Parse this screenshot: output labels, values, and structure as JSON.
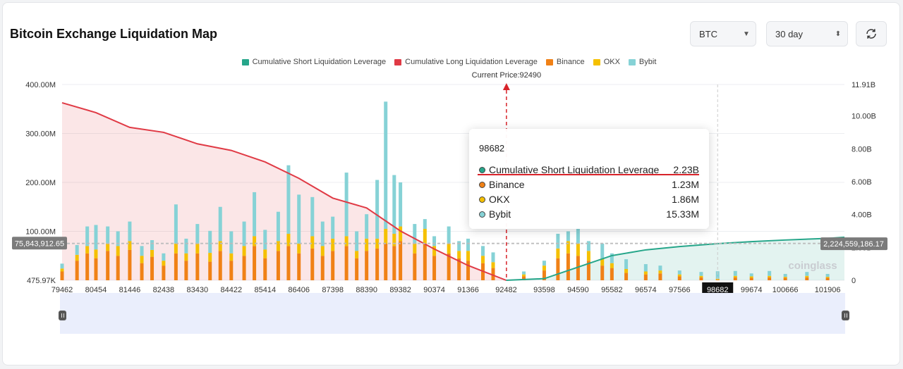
{
  "header": {
    "title": "Bitcoin Exchange Liquidation Map",
    "symbol_select": "BTC",
    "range_select": "30 day",
    "refresh_icon": "refresh-icon"
  },
  "colors": {
    "short": "#26a68a",
    "long": "#e03a45",
    "binance": "#f08116",
    "okx": "#f5c000",
    "bybit": "#86d2d6"
  },
  "current_price_label": "Current Price:92490",
  "left_marker_label": "75,843,912.65",
  "right_marker_label": "2,224,559,186.17",
  "watermark": "coinglass",
  "tooltip": {
    "title": "98682",
    "rows": [
      {
        "label": "Cumulative Short Liquidation Leverage",
        "value": "2.23B"
      },
      {
        "label": "Binance",
        "value": "1.23M"
      },
      {
        "label": "OKX",
        "value": "1.86M"
      },
      {
        "label": "Bybit",
        "value": "15.33M"
      }
    ]
  },
  "chart_data": {
    "type": "bar",
    "title": "Bitcoin Exchange Liquidation Map",
    "legend": [
      "Cumulative Short Liquidation Leverage",
      "Cumulative Long Liquidation Leverage",
      "Binance",
      "OKX",
      "Bybit"
    ],
    "legend_position": "top-center",
    "current_price": 92490,
    "hover_x": "98682",
    "x_ticks": [
      "79462",
      "80454",
      "81446",
      "82438",
      "83430",
      "84422",
      "85414",
      "86406",
      "87398",
      "88390",
      "89382",
      "90374",
      "91366",
      "92482",
      "93598",
      "94590",
      "95582",
      "96574",
      "97566",
      "98682",
      "99674",
      "100666",
      "101906"
    ],
    "x_range": [
      79462,
      102400
    ],
    "y_left_ticks": [
      "475.97K",
      "100.00M",
      "200.00M",
      "300.00M",
      "400.00M"
    ],
    "y_left_range": [
      0,
      400000000
    ],
    "y_right_ticks": [
      "0",
      "2.00B",
      "4.00B",
      "6.00B",
      "8.00B",
      "10.00B",
      "11.91B"
    ],
    "y_right_range": [
      0,
      11910000000
    ],
    "bar_series_note": "stacked per price level (millions)",
    "long_cumulative": {
      "name": "Cumulative Long Liquidation Leverage",
      "x": [
        79462,
        80454,
        81446,
        82438,
        83430,
        84422,
        85414,
        86406,
        87398,
        88390,
        89382,
        90374,
        91366,
        92482
      ],
      "y_b": [
        10.8,
        10.2,
        9.3,
        9.0,
        8.3,
        7.9,
        7.2,
        6.2,
        5.0,
        4.4,
        3.0,
        1.9,
        0.9,
        0.0
      ]
    },
    "short_cumulative": {
      "name": "Cumulative Short Liquidation Leverage",
      "x": [
        92482,
        93598,
        94590,
        95582,
        96574,
        97566,
        98682,
        99674,
        100666,
        101906,
        102400
      ],
      "y_b": [
        0.0,
        0.1,
        0.8,
        1.5,
        1.85,
        2.05,
        2.23,
        2.35,
        2.45,
        2.55,
        2.62
      ]
    },
    "stacks": [
      {
        "x": 79462,
        "binance": 18,
        "okx": 6,
        "bybit": 10
      },
      {
        "x": 79900,
        "binance": 40,
        "okx": 12,
        "bybit": 20
      },
      {
        "x": 80200,
        "binance": 55,
        "okx": 15,
        "bybit": 40
      },
      {
        "x": 80454,
        "binance": 45,
        "okx": 18,
        "bybit": 50
      },
      {
        "x": 80800,
        "binance": 60,
        "okx": 15,
        "bybit": 35
      },
      {
        "x": 81100,
        "binance": 50,
        "okx": 20,
        "bybit": 30
      },
      {
        "x": 81446,
        "binance": 62,
        "okx": 18,
        "bybit": 40
      },
      {
        "x": 81800,
        "binance": 35,
        "okx": 15,
        "bybit": 20
      },
      {
        "x": 82100,
        "binance": 48,
        "okx": 14,
        "bybit": 20
      },
      {
        "x": 82438,
        "binance": 30,
        "okx": 10,
        "bybit": 15
      },
      {
        "x": 82800,
        "binance": 55,
        "okx": 20,
        "bybit": 80
      },
      {
        "x": 83100,
        "binance": 40,
        "okx": 15,
        "bybit": 30
      },
      {
        "x": 83430,
        "binance": 55,
        "okx": 20,
        "bybit": 40
      },
      {
        "x": 83800,
        "binance": 38,
        "okx": 18,
        "bybit": 45
      },
      {
        "x": 84100,
        "binance": 60,
        "okx": 20,
        "bybit": 70
      },
      {
        "x": 84422,
        "binance": 40,
        "okx": 15,
        "bybit": 45
      },
      {
        "x": 84800,
        "binance": 50,
        "okx": 20,
        "bybit": 50
      },
      {
        "x": 85100,
        "binance": 70,
        "okx": 20,
        "bybit": 90
      },
      {
        "x": 85414,
        "binance": 45,
        "okx": 18,
        "bybit": 40
      },
      {
        "x": 85800,
        "binance": 60,
        "okx": 20,
        "bybit": 60
      },
      {
        "x": 86100,
        "binance": 70,
        "okx": 25,
        "bybit": 140
      },
      {
        "x": 86406,
        "binance": 55,
        "okx": 20,
        "bybit": 100
      },
      {
        "x": 86800,
        "binance": 65,
        "okx": 25,
        "bybit": 80
      },
      {
        "x": 87100,
        "binance": 50,
        "okx": 20,
        "bybit": 50
      },
      {
        "x": 87398,
        "binance": 60,
        "okx": 25,
        "bybit": 45
      },
      {
        "x": 87800,
        "binance": 70,
        "okx": 20,
        "bybit": 130
      },
      {
        "x": 88100,
        "binance": 45,
        "okx": 15,
        "bybit": 40
      },
      {
        "x": 88390,
        "binance": 60,
        "okx": 25,
        "bybit": 50
      },
      {
        "x": 88700,
        "binance": 65,
        "okx": 20,
        "bybit": 120
      },
      {
        "x": 88950,
        "binance": 75,
        "okx": 30,
        "bybit": 260
      },
      {
        "x": 89200,
        "binance": 70,
        "okx": 25,
        "bybit": 120
      },
      {
        "x": 89382,
        "binance": 80,
        "okx": 30,
        "bybit": 90
      },
      {
        "x": 89800,
        "binance": 55,
        "okx": 20,
        "bybit": 40
      },
      {
        "x": 90100,
        "binance": 75,
        "okx": 30,
        "bybit": 20
      },
      {
        "x": 90374,
        "binance": 50,
        "okx": 20,
        "bybit": 20
      },
      {
        "x": 90800,
        "binance": 55,
        "okx": 20,
        "bybit": 35
      },
      {
        "x": 91100,
        "binance": 45,
        "okx": 15,
        "bybit": 20
      },
      {
        "x": 91366,
        "binance": 40,
        "okx": 20,
        "bybit": 25
      },
      {
        "x": 91800,
        "binance": 35,
        "okx": 15,
        "bybit": 20
      },
      {
        "x": 92100,
        "binance": 25,
        "okx": 12,
        "bybit": 20
      },
      {
        "x": 93000,
        "binance": 8,
        "okx": 4,
        "bybit": 6
      },
      {
        "x": 93598,
        "binance": 20,
        "okx": 10,
        "bybit": 10
      },
      {
        "x": 94000,
        "binance": 45,
        "okx": 20,
        "bybit": 30
      },
      {
        "x": 94300,
        "binance": 55,
        "okx": 25,
        "bybit": 20
      },
      {
        "x": 94590,
        "binance": 50,
        "okx": 25,
        "bybit": 30
      },
      {
        "x": 94900,
        "binance": 40,
        "okx": 20,
        "bybit": 20
      },
      {
        "x": 95300,
        "binance": 30,
        "okx": 15,
        "bybit": 30
      },
      {
        "x": 95582,
        "binance": 25,
        "okx": 10,
        "bybit": 20
      },
      {
        "x": 96000,
        "binance": 15,
        "okx": 8,
        "bybit": 20
      },
      {
        "x": 96574,
        "binance": 12,
        "okx": 6,
        "bybit": 15
      },
      {
        "x": 97000,
        "binance": 14,
        "okx": 6,
        "bybit": 10
      },
      {
        "x": 97566,
        "binance": 8,
        "okx": 4,
        "bybit": 8
      },
      {
        "x": 98200,
        "binance": 6,
        "okx": 3,
        "bybit": 8
      },
      {
        "x": 98682,
        "binance": 1.23,
        "okx": 1.86,
        "bybit": 15.33
      },
      {
        "x": 99200,
        "binance": 6,
        "okx": 3,
        "bybit": 10
      },
      {
        "x": 99674,
        "binance": 5,
        "okx": 3,
        "bybit": 6
      },
      {
        "x": 100200,
        "binance": 6,
        "okx": 3,
        "bybit": 10
      },
      {
        "x": 100666,
        "binance": 5,
        "okx": 2,
        "bybit": 6
      },
      {
        "x": 101300,
        "binance": 6,
        "okx": 3,
        "bybit": 8
      },
      {
        "x": 101906,
        "binance": 5,
        "okx": 2,
        "bybit": 6
      }
    ]
  }
}
